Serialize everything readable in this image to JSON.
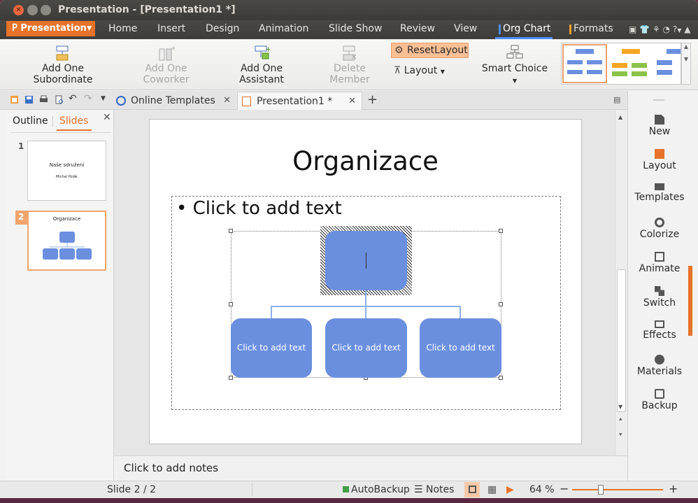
{
  "window": {
    "title": "Presentation - [Presentation1 *]"
  },
  "app_menu": {
    "label": "Presentation"
  },
  "menus": [
    "Home",
    "Insert",
    "Design",
    "Animation",
    "Slide Show",
    "Review",
    "View",
    "Org Chart",
    "Formats"
  ],
  "ribbon": {
    "add_subordinate": "Add One Subordinate",
    "add_coworker": "Add One Coworker",
    "add_assistant": "Add One Assistant",
    "delete_member": "Delete Member",
    "reset_layout": "ResetLayout",
    "layout": "Layout",
    "smart_choice": "Smart Choice"
  },
  "tabs": {
    "online_templates": "Online Templates",
    "presentation": "Presentation1 *"
  },
  "left_panel": {
    "outline": "Outline",
    "slides": "Slides",
    "slide1_num": "1",
    "slide1_title": "Naše sdružení",
    "slide1_sub": "Michal Polák",
    "slide2_num": "2",
    "slide2_title": "Organizace"
  },
  "slide": {
    "title": "Organizace",
    "bullet": "Click to add text",
    "node1": "Click to add text",
    "node2": "Click to add text",
    "node3": "Click to add text"
  },
  "notes": "Click to add notes",
  "right_panel": [
    "New",
    "Layout",
    "Templates",
    "Colorize",
    "Animate",
    "Switch",
    "Effects",
    "Materials",
    "Backup"
  ],
  "status": {
    "slide": "Slide 2 / 2",
    "autobackup": "AutoBackup",
    "notes": "Notes",
    "zoom": "64 %"
  },
  "colors": {
    "accent": "#e67329",
    "node": "#6a8fdf"
  }
}
